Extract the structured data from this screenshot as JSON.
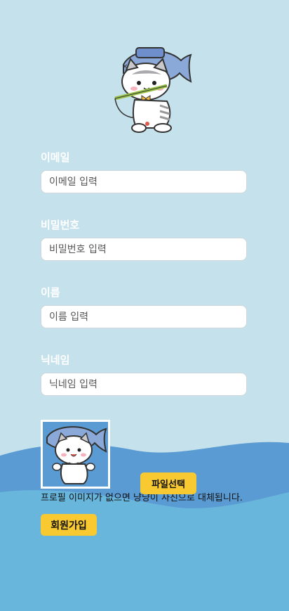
{
  "colors": {
    "background": "#c5e2ec",
    "wave_dark": "#5b9bd3",
    "wave_light": "#68b6dc",
    "button": "#f8c931"
  },
  "form": {
    "email": {
      "label": "이메일",
      "placeholder": "이메일 입력"
    },
    "password": {
      "label": "비밀번호",
      "placeholder": "비밀번호 입력"
    },
    "name": {
      "label": "이름",
      "placeholder": "이름 입력"
    },
    "nickname": {
      "label": "닉네임",
      "placeholder": "닉네임 입력"
    }
  },
  "profile": {
    "image_icon": "cat-mascot-icon",
    "file_button_label": "파일선택",
    "note": "프로필 이미지가 없으면 냥냥이 사진으로 대체됩니다."
  },
  "signup_button_label": "회원가입"
}
